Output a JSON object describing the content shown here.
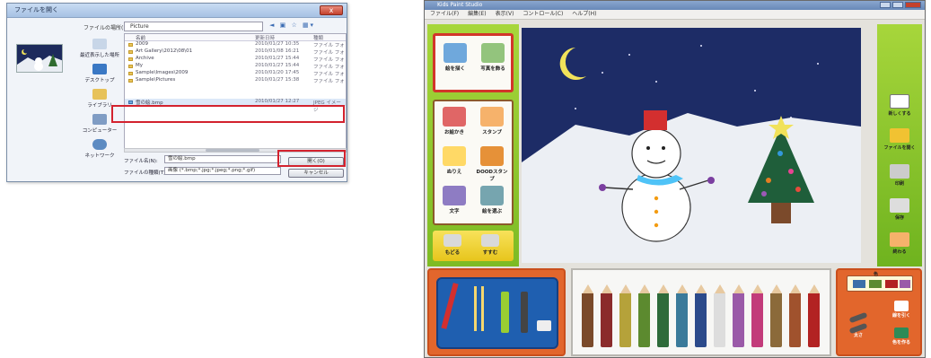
{
  "dialog": {
    "title": "ファイルを開く",
    "close_label": "x",
    "location_label": "ファイルの場所(I):",
    "location_value": "Picture",
    "toolbar_icons": "◄ ▣ ☆ ▦▾",
    "places": [
      {
        "label": "最近表示した場所"
      },
      {
        "label": "デスクトップ"
      },
      {
        "label": "ライブラリ"
      },
      {
        "label": "コンピューター"
      },
      {
        "label": "ネットワーク"
      }
    ],
    "columns": {
      "name": "名前",
      "date": "更新日時",
      "type": "種類"
    },
    "files": [
      {
        "name": "2009",
        "date": "2010/01/27 10:35",
        "type": "ファイル フォ"
      },
      {
        "name": "Art Gallery\\2012\\08\\01",
        "date": "2010/01/08 16:21",
        "type": "ファイル フォ"
      },
      {
        "name": "Archive",
        "date": "2010/01/27 15:44",
        "type": "ファイル フォ"
      },
      {
        "name": "My",
        "date": "2010/01/27 15:44",
        "type": "ファイル フォ"
      },
      {
        "name": "Sample\\Images\\2009",
        "date": "2010/01/20 17:45",
        "type": "ファイル フォ"
      },
      {
        "name": "Sample\\Pictures",
        "date": "2010/01/27 15:38",
        "type": "ファイル フォ"
      },
      {
        "name": "雪の絵.bmp",
        "date": "2010/01/27 12:27",
        "type": "JPEG イメージ",
        "selected": true
      }
    ],
    "filename_label": "ファイル名(N):",
    "filename_value": "雪の絵.bmp",
    "filetype_label": "ファイルの種類(T):",
    "filetype_value": "画像 (*.bmp;*.jpg;*.jpeg;*.png;*.gif)",
    "open_label": "開く(O)",
    "cancel_label": "キャンセル"
  },
  "app": {
    "title": "Kids Paint Studio",
    "menu": [
      "ファイル(F)",
      "編集(E)",
      "表示(V)",
      "コントロール(C)",
      "ヘルプ(H)"
    ],
    "left_tools_top": [
      {
        "label": "絵を描く",
        "icon": "draw-picture-icon",
        "color": "#6fa8dc"
      },
      {
        "label": "写真を飾る",
        "icon": "photo-frame-icon",
        "color": "#93c47d"
      }
    ],
    "left_tools": [
      {
        "label": "お絵かき",
        "icon": "crayons-icon",
        "color": "#e06666"
      },
      {
        "label": "スタンプ",
        "icon": "stamp-icon",
        "color": "#f6b26b"
      },
      {
        "label": "ぬりえ",
        "icon": "coloring-icon",
        "color": "#ffd966"
      },
      {
        "label": "DOODスタンプ",
        "icon": "character-stamp-icon",
        "color": "#e69138"
      },
      {
        "label": "文字",
        "icon": "letters-icon",
        "color": "#8e7cc3"
      },
      {
        "label": "絵を選ぶ",
        "icon": "picture-select-icon",
        "color": "#76a5af"
      }
    ],
    "left_bottom": [
      {
        "label": "もどる",
        "icon": "undo-icon"
      },
      {
        "label": "すすむ",
        "icon": "redo-icon"
      }
    ],
    "right_tools": [
      {
        "label": "新しくする",
        "icon": "new-page-icon",
        "color": "#ffffff"
      },
      {
        "label": "ファイルを開く",
        "icon": "open-folder-icon",
        "color": "#f1c232"
      },
      {
        "label": "印刷",
        "icon": "printer-icon",
        "color": "#cccccc"
      },
      {
        "label": "保存",
        "icon": "save-icon",
        "color": "#dddddd"
      },
      {
        "label": "終わる",
        "icon": "exit-door-icon",
        "color": "#f6b26b"
      }
    ],
    "pencil_colors": [
      "#7a4a2a",
      "#8b2b2b",
      "#b5a23a",
      "#5c8a2f",
      "#2e6b3a",
      "#3a7a9a",
      "#2b4a8b",
      "#dddddd",
      "#9a5aa8",
      "#c23b7a",
      "#8b6a3a",
      "#a0522d",
      "#b22222"
    ],
    "palette_label": "色",
    "bright_labels": [
      {
        "label": "線を引く",
        "icon": "line-pen-icon"
      },
      {
        "label": "太さ",
        "icon": "thickness-icon"
      },
      {
        "label": "色を作る",
        "icon": "color-mix-icon"
      }
    ]
  }
}
